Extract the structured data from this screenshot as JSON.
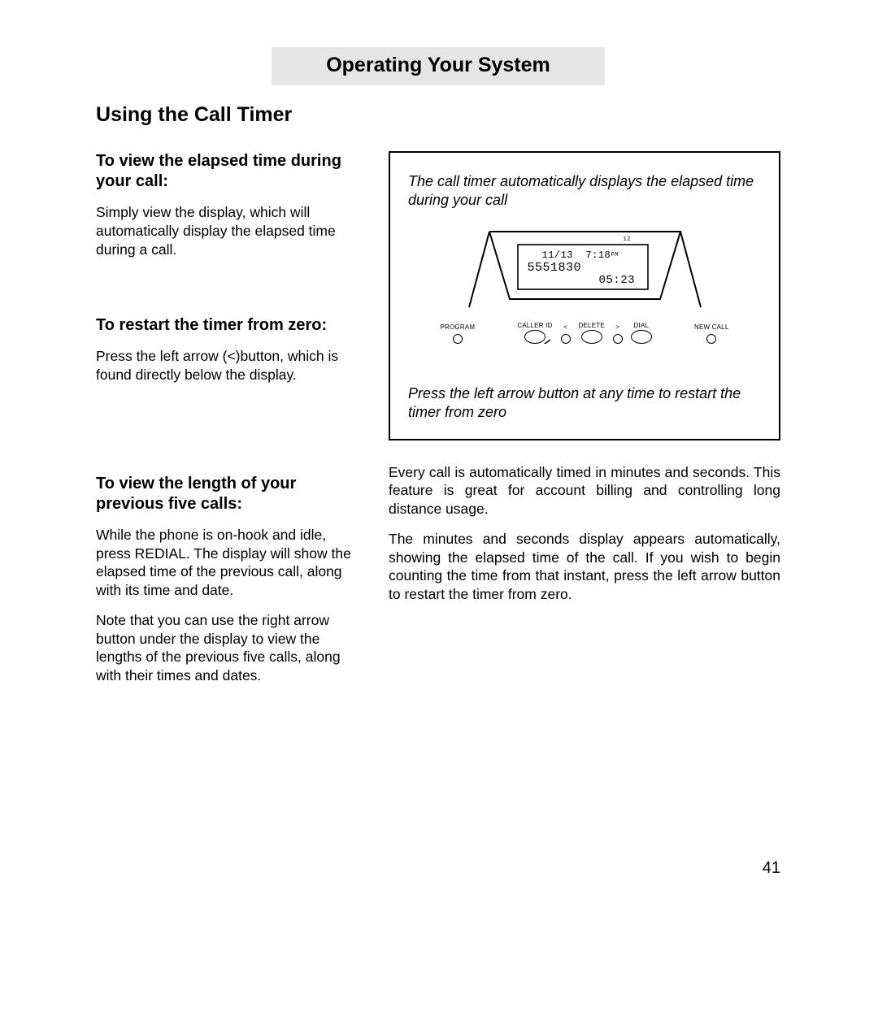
{
  "header": {
    "title": "Operating Your System"
  },
  "section": {
    "title": "Using the Call Timer"
  },
  "left": {
    "block1": {
      "heading": "To view the elapsed time during your call:",
      "body": "Simply view the display, which will automatically display the elapsed time during a call."
    },
    "block2": {
      "heading": "To restart the timer from zero:",
      "body": "Press the left arrow (<)button, which is found directly below the display."
    },
    "block3": {
      "heading": "To view the length of your previous five calls:",
      "body1": "While the phone is on-hook and idle, press REDIAL.  The display will show the elapsed time of the previous call, along with its time and date.",
      "body2": "Note that you can use the right arrow button under the display to view the lengths of the previous five calls, along with their times and dates."
    }
  },
  "figure": {
    "caption_top": "The call timer automatically displays the elapsed time during your call",
    "caption_bottom": "Press the left arrow button at any time to restart the timer from zero",
    "lcd": {
      "date": "11/13",
      "time": "7:18",
      "ampm": "PM",
      "number": "5551830",
      "timer": "05:23",
      "top_num": "12"
    },
    "buttons": {
      "program": "PROGRAM",
      "callerid": "CALLER ID",
      "left": "<",
      "delete": "DELETE",
      "right": ">",
      "dial": "DIAL",
      "newcall": "NEW CALL"
    }
  },
  "right": {
    "para1": "Every call is automatically timed in minutes and seconds.  This feature is great for account billing and controlling long distance usage.",
    "para2": "The minutes and seconds display appears automatically, showing the elapsed time of the call.  If you wish to begin counting the time from that instant, press the left arrow button to restart the timer from zero."
  },
  "page_number": "41"
}
